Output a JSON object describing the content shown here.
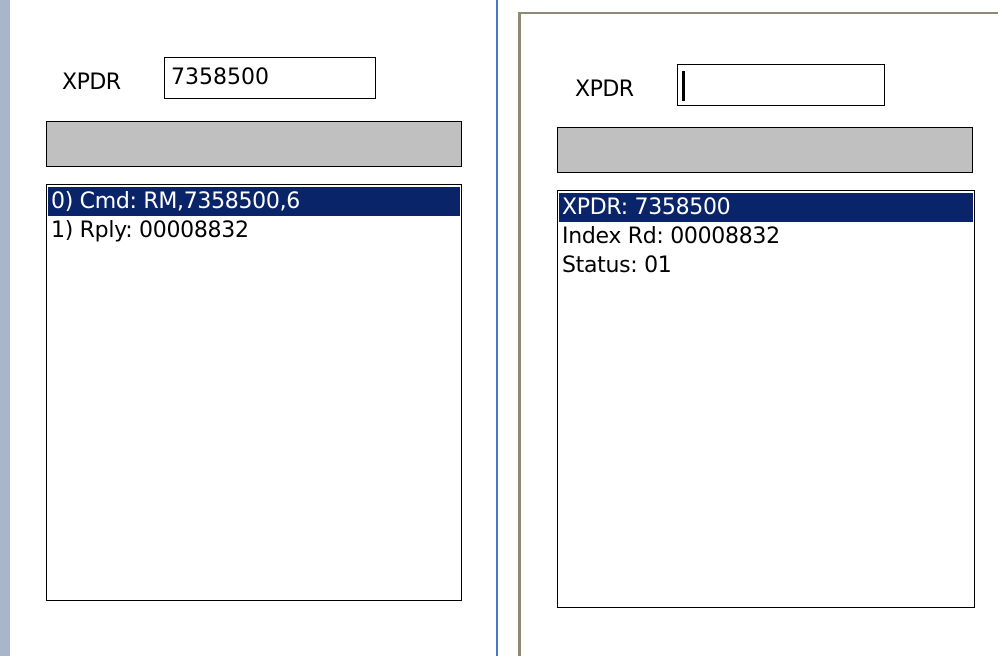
{
  "left_panel": {
    "xpdr_label": "XPDR",
    "xpdr_value": "7358500",
    "status_text": "",
    "items": [
      {
        "text": "0) Cmd: RM,7358500,6",
        "selected": true
      },
      {
        "text": "1) Rply: 00008832",
        "selected": false
      }
    ]
  },
  "right_panel": {
    "xpdr_label": "XPDR",
    "xpdr_value": "",
    "status_text": "",
    "items": [
      {
        "text": "XPDR: 7358500",
        "selected": true
      },
      {
        "text": "Index Rd: 00008832",
        "selected": false
      },
      {
        "text": "Status: 01",
        "selected": false
      }
    ]
  },
  "colors": {
    "selection": "#0a246a",
    "status_bar": "#c0c0c0"
  }
}
